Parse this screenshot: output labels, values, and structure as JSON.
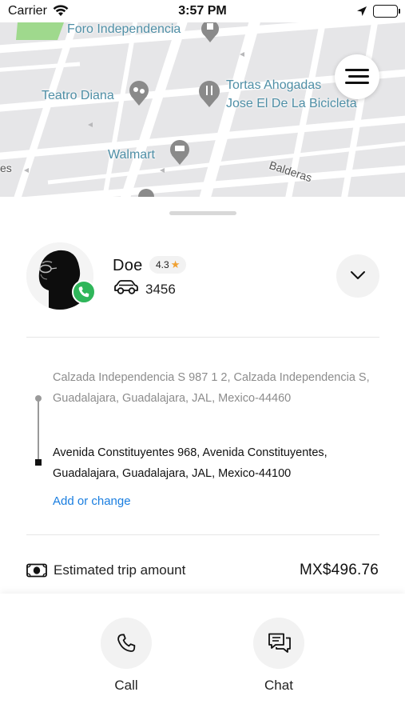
{
  "status_bar": {
    "carrier": "Carrier",
    "time": "3:57 PM"
  },
  "map": {
    "labels": {
      "foro": "Foro Independencia",
      "teatro": "Teatro Diana",
      "tortas_line1": "Tortas Ahogadas",
      "tortas_line2": "Jose El De La Bicicleta",
      "walmart": "Walmart",
      "balderas": "Balderas",
      "partial_left": "es"
    },
    "colors": {
      "background": "#e6e6e8",
      "street": "#ffffff",
      "park": "#9fd98d",
      "label": "#4f8fa6",
      "poi_pin": "#8a8a8a"
    }
  },
  "driver": {
    "name": "Doe",
    "rating": "4.3",
    "plate": "3456"
  },
  "route": {
    "pickup": "Calzada Independencia S 987 1 2, Calzada Independencia S, Guadalajara, Guadalajara, JAL, Mexico-44460",
    "dropoff": "Avenida Constituyentes 968, Avenida Constituyentes, Guadalajara, Guadalajara, JAL, Mexico-44100",
    "add_change_label": "Add or change"
  },
  "fare": {
    "label": "Estimated trip amount",
    "amount": "MX$496.76"
  },
  "actions": {
    "call_label": "Call",
    "chat_label": "Chat"
  },
  "icons": {
    "menu": "hamburger-icon",
    "expand": "chevron-down-icon",
    "car": "car-icon",
    "cash": "cash-icon",
    "call": "phone-icon",
    "chat": "chat-bubbles-icon",
    "rating": "star-icon"
  },
  "colors": {
    "accent_link": "#1a7ee0",
    "phone_badge": "#2fb65a",
    "star": "#f0a030"
  }
}
